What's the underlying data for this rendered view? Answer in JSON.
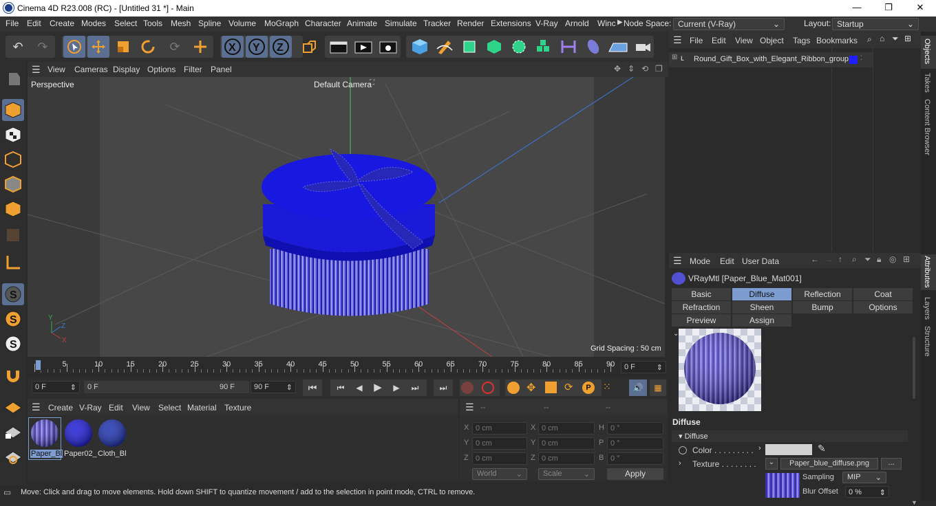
{
  "window": {
    "title": "Cinema 4D R23.008 (RC) - [Untitled 31 *] - Main",
    "minimize": "—",
    "maximize": "❐",
    "close": "✕"
  },
  "menu": {
    "items": [
      "File",
      "Edit",
      "Create",
      "Modes",
      "Select",
      "Tools",
      "Mesh",
      "Spline",
      "Volume",
      "MoGraph",
      "Character",
      "Animate",
      "Simulate",
      "Tracker",
      "Render",
      "Extensions",
      "V-Ray",
      "Arnold",
      "Winc"
    ],
    "node_space_label": "Node Space:",
    "node_space_value": "Current (V-Ray)",
    "layout_label": "Layout:",
    "layout_value": "Startup"
  },
  "viewport": {
    "menu": [
      "View",
      "Cameras",
      "Display",
      "Options",
      "Filter",
      "Panel"
    ],
    "projection": "Perspective",
    "camera": "Default Camera",
    "grid_spacing": "Grid Spacing : 50 cm"
  },
  "timeline": {
    "ticks": [
      "0",
      "5",
      "10",
      "15",
      "20",
      "25",
      "30",
      "35",
      "40",
      "45",
      "50",
      "55",
      "60",
      "65",
      "70",
      "75",
      "80",
      "85",
      "90"
    ],
    "current_frame": "0 F"
  },
  "transport": {
    "start": "0 F",
    "range_start": "0 F",
    "range_end": "90 F",
    "end": "90 F"
  },
  "material_manager": {
    "menu": [
      "Create",
      "V-Ray",
      "Edit",
      "View",
      "Select",
      "Material",
      "Texture"
    ],
    "materials": [
      {
        "name": "Paper_Bl",
        "color": "stripes"
      },
      {
        "name": "Paper02_",
        "color": "#1a1ad8"
      },
      {
        "name": "Cloth_Bl",
        "color": "#1a2fb0"
      }
    ]
  },
  "coords": {
    "headers": [
      "--",
      "--",
      "--"
    ],
    "rows": [
      {
        "a": "X",
        "av": "0 cm",
        "b": "X",
        "bv": "0 cm",
        "c": "H",
        "cv": "0 °"
      },
      {
        "a": "Y",
        "av": "0 cm",
        "b": "Y",
        "bv": "0 cm",
        "c": "P",
        "cv": "0 °"
      },
      {
        "a": "Z",
        "av": "0 cm",
        "b": "Z",
        "bv": "0 cm",
        "c": "B",
        "cv": "0 °"
      }
    ],
    "world": "World",
    "scale": "Scale",
    "apply": "Apply"
  },
  "status": {
    "text": "Move: Click and drag to move elements. Hold down SHIFT to quantize movement / add to the selection in point mode, CTRL to remove."
  },
  "objects": {
    "menu": [
      "File",
      "Edit",
      "View",
      "Object",
      "Tags",
      "Bookmarks"
    ],
    "items": [
      {
        "name": "Round_Gift_Box_with_Elegant_Ribbon_group"
      }
    ]
  },
  "attributes": {
    "menu": [
      "Mode",
      "Edit",
      "User Data"
    ],
    "material_title": "VRayMtl [Paper_Blue_Mat001]",
    "tabs_row1": [
      "Basic",
      "Diffuse",
      "Reflection",
      "Coat"
    ],
    "tabs_row2": [
      "Refraction",
      "Sheen",
      "Bump",
      "Options"
    ],
    "tabs_row3": [
      "Preview Settings",
      "Assign"
    ],
    "active_tab": "Diffuse",
    "section": "Diffuse",
    "subsection": "Diffuse",
    "color_label": "Color . . . . . . . . .",
    "texture_label": "Texture . . . . . . . .",
    "texture_file": "Paper_blue_diffuse.png",
    "texture_more": "...",
    "sampling_label": "Sampling",
    "sampling_value": "MIP",
    "blur_label": "Blur Offset",
    "blur_value": "0 %"
  },
  "side_tabs": [
    "Objects",
    "Takes",
    "Content Browser",
    "Attributes",
    "Layers",
    "Structure"
  ],
  "colors": {
    "accent": "#7d9ccf",
    "box": "#1a1ad8",
    "selection": "#5a6f92"
  }
}
